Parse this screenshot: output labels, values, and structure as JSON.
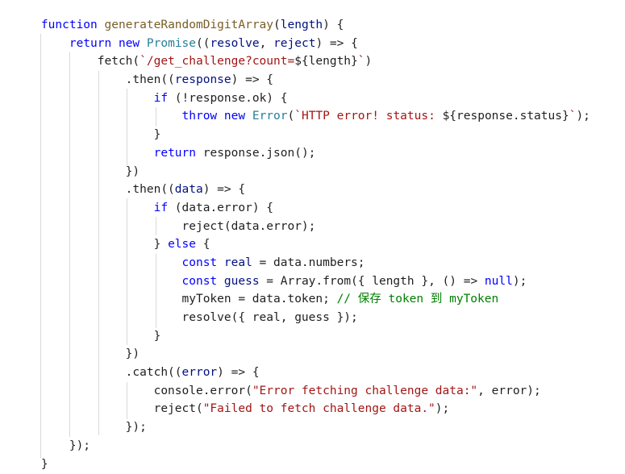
{
  "colors": {
    "background": "#ffffff",
    "keyword": "#0000ff",
    "function": "#795e26",
    "parameter": "#001080",
    "type": "#267f99",
    "string": "#a31515",
    "comment": "#008000",
    "text": "#1f1f1f",
    "indent_guide": "#d9d9d9"
  },
  "code": {
    "lines": [
      [
        {
          "t": "    ",
          "c": "plain"
        },
        {
          "t": "function",
          "c": "kw"
        },
        {
          "t": " ",
          "c": "plain"
        },
        {
          "t": "generateRandomDigitArray",
          "c": "fn"
        },
        {
          "t": "(",
          "c": "plain"
        },
        {
          "t": "length",
          "c": "param"
        },
        {
          "t": ") {",
          "c": "plain"
        }
      ],
      [
        {
          "t": "        ",
          "c": "plain"
        },
        {
          "t": "return",
          "c": "kw"
        },
        {
          "t": " ",
          "c": "plain"
        },
        {
          "t": "new",
          "c": "kw"
        },
        {
          "t": " ",
          "c": "plain"
        },
        {
          "t": "Promise",
          "c": "type"
        },
        {
          "t": "((",
          "c": "plain"
        },
        {
          "t": "resolve",
          "c": "param"
        },
        {
          "t": ", ",
          "c": "plain"
        },
        {
          "t": "reject",
          "c": "param"
        },
        {
          "t": ") => {",
          "c": "plain"
        }
      ],
      [
        {
          "t": "            fetch(",
          "c": "plain"
        },
        {
          "t": "`/get_challenge?count=",
          "c": "str"
        },
        {
          "t": "${length}",
          "c": "plain"
        },
        {
          "t": "`",
          "c": "str"
        },
        {
          "t": ")",
          "c": "plain"
        }
      ],
      [
        {
          "t": "                .then((",
          "c": "plain"
        },
        {
          "t": "response",
          "c": "param"
        },
        {
          "t": ") => {",
          "c": "plain"
        }
      ],
      [
        {
          "t": "                    ",
          "c": "plain"
        },
        {
          "t": "if",
          "c": "kw"
        },
        {
          "t": " (!response.ok) {",
          "c": "plain"
        }
      ],
      [
        {
          "t": "                        ",
          "c": "plain"
        },
        {
          "t": "throw",
          "c": "kw"
        },
        {
          "t": " ",
          "c": "plain"
        },
        {
          "t": "new",
          "c": "kw"
        },
        {
          "t": " ",
          "c": "plain"
        },
        {
          "t": "Error",
          "c": "type"
        },
        {
          "t": "(",
          "c": "plain"
        },
        {
          "t": "`HTTP error! status: ",
          "c": "str"
        },
        {
          "t": "${response.status}",
          "c": "plain"
        },
        {
          "t": "`",
          "c": "str"
        },
        {
          "t": ");",
          "c": "plain"
        }
      ],
      [
        {
          "t": "                    }",
          "c": "plain"
        }
      ],
      [
        {
          "t": "                    ",
          "c": "plain"
        },
        {
          "t": "return",
          "c": "kw"
        },
        {
          "t": " response.json();",
          "c": "plain"
        }
      ],
      [
        {
          "t": "                })",
          "c": "plain"
        }
      ],
      [
        {
          "t": "                .then((",
          "c": "plain"
        },
        {
          "t": "data",
          "c": "param"
        },
        {
          "t": ") => {",
          "c": "plain"
        }
      ],
      [
        {
          "t": "                    ",
          "c": "plain"
        },
        {
          "t": "if",
          "c": "kw"
        },
        {
          "t": " (data.error) {",
          "c": "plain"
        }
      ],
      [
        {
          "t": "                        reject(data.error);",
          "c": "plain"
        }
      ],
      [
        {
          "t": "                    } ",
          "c": "plain"
        },
        {
          "t": "else",
          "c": "kw"
        },
        {
          "t": " {",
          "c": "plain"
        }
      ],
      [
        {
          "t": "                        ",
          "c": "plain"
        },
        {
          "t": "const",
          "c": "kw"
        },
        {
          "t": " ",
          "c": "plain"
        },
        {
          "t": "real",
          "c": "param"
        },
        {
          "t": " = data.numbers;",
          "c": "plain"
        }
      ],
      [
        {
          "t": "                        ",
          "c": "plain"
        },
        {
          "t": "const",
          "c": "kw"
        },
        {
          "t": " ",
          "c": "plain"
        },
        {
          "t": "guess",
          "c": "param"
        },
        {
          "t": " = Array.from({ length }, () => ",
          "c": "plain"
        },
        {
          "t": "null",
          "c": "kw"
        },
        {
          "t": ");",
          "c": "plain"
        }
      ],
      [
        {
          "t": "                        myToken = data.token; ",
          "c": "plain"
        },
        {
          "t": "// 保存 token 到 myToken",
          "c": "com"
        }
      ],
      [
        {
          "t": "                        resolve({ real, guess });",
          "c": "plain"
        }
      ],
      [
        {
          "t": "                    }",
          "c": "plain"
        }
      ],
      [
        {
          "t": "                })",
          "c": "plain"
        }
      ],
      [
        {
          "t": "                .catch((",
          "c": "plain"
        },
        {
          "t": "error",
          "c": "param"
        },
        {
          "t": ") => {",
          "c": "plain"
        }
      ],
      [
        {
          "t": "                    console.error(",
          "c": "plain"
        },
        {
          "t": "\"Error fetching challenge data:\"",
          "c": "str"
        },
        {
          "t": ", error);",
          "c": "plain"
        }
      ],
      [
        {
          "t": "                    reject(",
          "c": "plain"
        },
        {
          "t": "\"Failed to fetch challenge data.\"",
          "c": "str"
        },
        {
          "t": ");",
          "c": "plain"
        }
      ],
      [
        {
          "t": "                });",
          "c": "plain"
        }
      ],
      [
        {
          "t": "        });",
          "c": "plain"
        }
      ],
      [
        {
          "t": "    }",
          "c": "plain"
        }
      ]
    ]
  }
}
